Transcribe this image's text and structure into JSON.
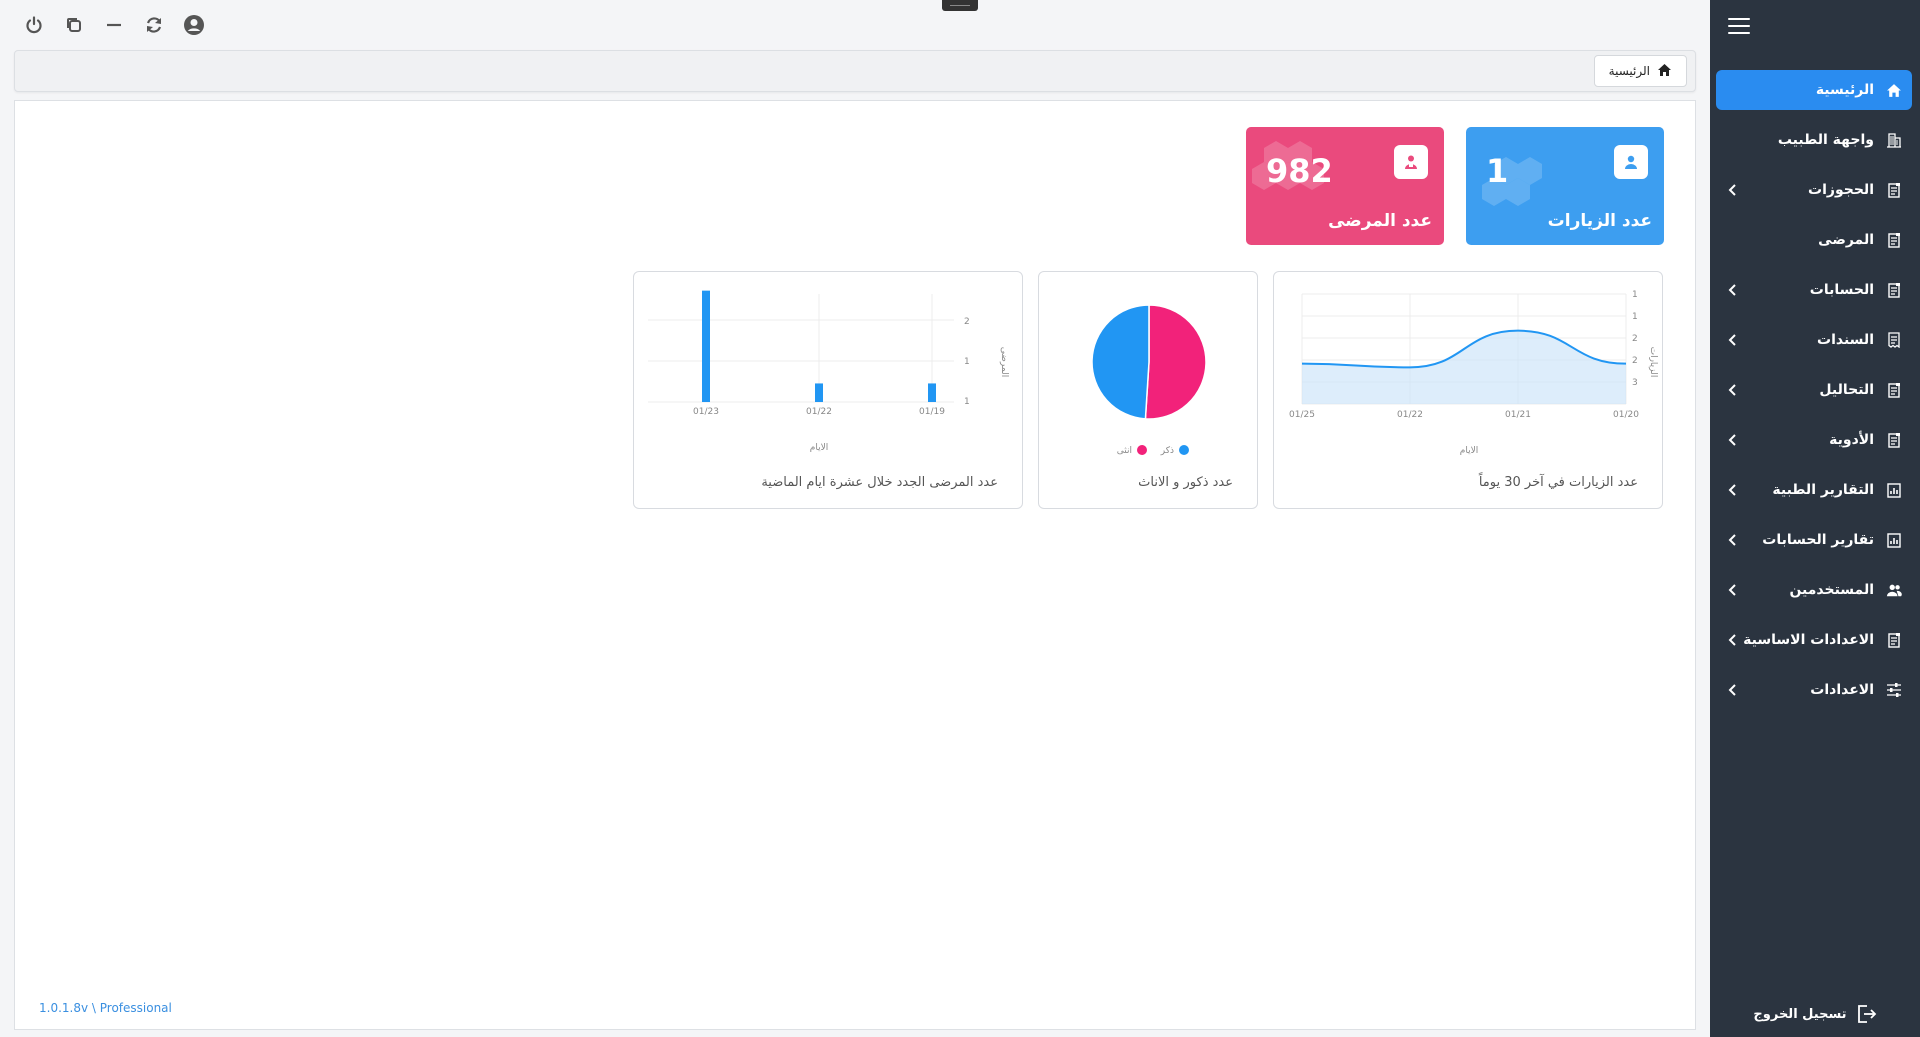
{
  "colors": {
    "sidebar_bg": "#2b3440",
    "accent": "#2a8cf0",
    "blue_card": "#3d9ef0",
    "pink_card": "#ea4a7d",
    "male": "#2196f3",
    "female": "#f2227a"
  },
  "topbar": {
    "icons": [
      "power-icon",
      "restore-window-icon",
      "minimize-icon",
      "refresh-icon",
      "user-circle-icon"
    ]
  },
  "breadcrumb": {
    "label": "الرئيسية",
    "icon": "home-icon"
  },
  "sidebar": {
    "items": [
      {
        "label": "الرئيسية",
        "icon": "home-icon",
        "active": true,
        "has_sub": false
      },
      {
        "label": "واجهة الطبيب",
        "icon": "building-icon",
        "active": false,
        "has_sub": false
      },
      {
        "label": "الحجوزات",
        "icon": "document-icon",
        "active": false,
        "has_sub": true
      },
      {
        "label": "المرضى",
        "icon": "document-icon",
        "active": false,
        "has_sub": false
      },
      {
        "label": "الحسابات",
        "icon": "document-icon",
        "active": false,
        "has_sub": true
      },
      {
        "label": "السندات",
        "icon": "receipt-icon",
        "active": false,
        "has_sub": true
      },
      {
        "label": "التحاليل",
        "icon": "document-icon",
        "active": false,
        "has_sub": true
      },
      {
        "label": "الأدوية",
        "icon": "document-icon",
        "active": false,
        "has_sub": true
      },
      {
        "label": "التقارير الطبية",
        "icon": "report-icon",
        "active": false,
        "has_sub": true
      },
      {
        "label": "تقارير الحسابات",
        "icon": "report-icon",
        "active": false,
        "has_sub": true
      },
      {
        "label": "المستخدمين",
        "icon": "users-icon",
        "active": false,
        "has_sub": true
      },
      {
        "label": "الاعدادات الاساسية",
        "icon": "document-icon",
        "active": false,
        "has_sub": true
      },
      {
        "label": "الاعدادات",
        "icon": "sliders-icon",
        "active": false,
        "has_sub": true
      }
    ],
    "logout_label": "تسجيل الخروج"
  },
  "stats": {
    "visits": {
      "value": "1",
      "label": "عدد الزيارات"
    },
    "patients": {
      "value": "982",
      "label": "عدد المرضى"
    }
  },
  "charts": {
    "visits_title": "عدد الزيارات في آخر 30 يوماً",
    "gender_title": "عدد ذكور و الاناث",
    "new_patients_title": "عدد المرضى الجدد خلال عشرة ايام الماضية",
    "gender_legend": {
      "male": "ذكر",
      "female": "انثى"
    }
  },
  "chart_data": [
    {
      "type": "area",
      "title": "عدد الزيارات في آخر 30 يوماً",
      "xlabel": "الايام",
      "ylabel": "الزيارات",
      "x": [
        "01/25",
        "01/22",
        "01/21",
        "01/20"
      ],
      "values": [
        1.1,
        1.0,
        2.0,
        1.1
      ],
      "y_ticks": [
        "1",
        "1",
        "2",
        "2",
        "3"
      ],
      "ylim": [
        0,
        3
      ],
      "grid": true
    },
    {
      "type": "pie",
      "title": "عدد ذكور و الاناث",
      "categories": [
        "ذكر",
        "انثى"
      ],
      "values": [
        49,
        51
      ],
      "colors": [
        "#2196f3",
        "#f2227a"
      ],
      "legend": "bottom"
    },
    {
      "type": "bar",
      "title": "عدد المرضى الجدد خلال عشرة ايام الماضية",
      "xlabel": "الايام",
      "ylabel": "المرضى",
      "categories": [
        "01/23",
        "01/22",
        "01/19"
      ],
      "values": [
        2.4,
        0.4,
        0.4
      ],
      "y_ticks": [
        "1",
        "1",
        "2"
      ],
      "ylim": [
        0,
        2.5
      ],
      "grid": true
    }
  ],
  "footer": {
    "version": "1.0.1.8v \\ Professional"
  }
}
